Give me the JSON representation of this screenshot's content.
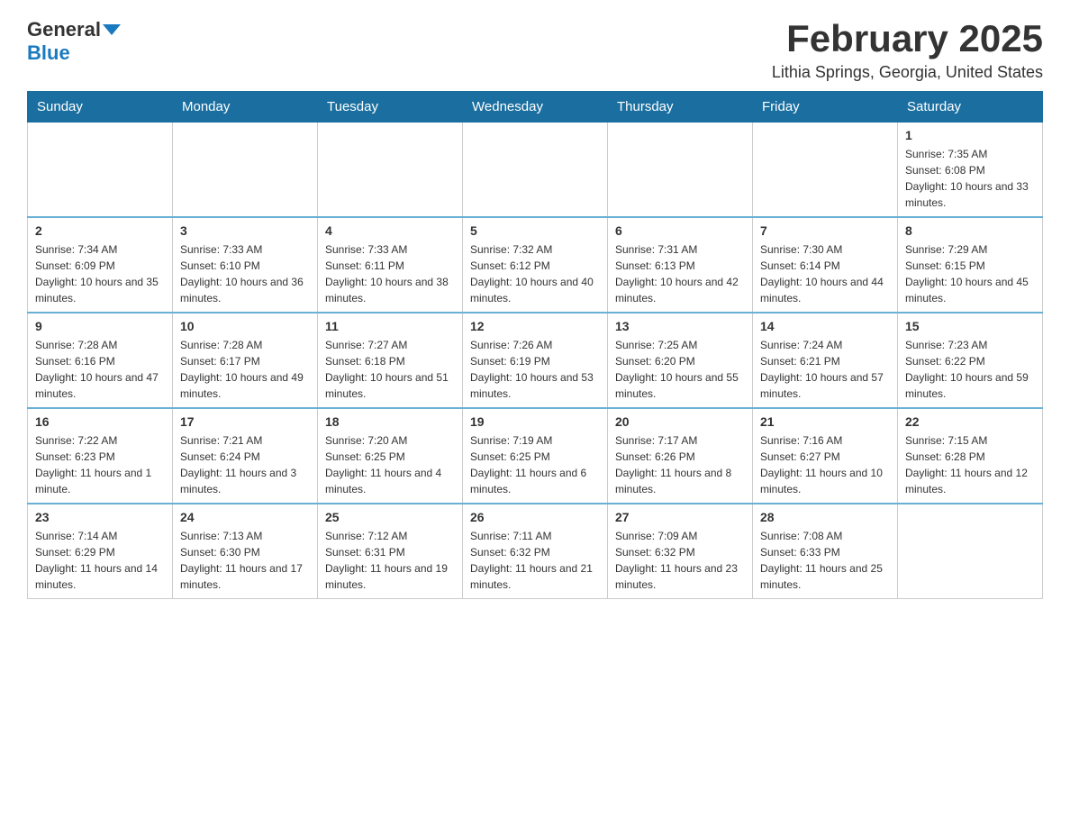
{
  "header": {
    "logo_text_black": "General",
    "logo_text_blue": "Blue",
    "month_title": "February 2025",
    "location": "Lithia Springs, Georgia, United States"
  },
  "days_of_week": [
    "Sunday",
    "Monday",
    "Tuesday",
    "Wednesday",
    "Thursday",
    "Friday",
    "Saturday"
  ],
  "weeks": [
    [
      {
        "day": "",
        "info": ""
      },
      {
        "day": "",
        "info": ""
      },
      {
        "day": "",
        "info": ""
      },
      {
        "day": "",
        "info": ""
      },
      {
        "day": "",
        "info": ""
      },
      {
        "day": "",
        "info": ""
      },
      {
        "day": "1",
        "info": "Sunrise: 7:35 AM\nSunset: 6:08 PM\nDaylight: 10 hours and 33 minutes."
      }
    ],
    [
      {
        "day": "2",
        "info": "Sunrise: 7:34 AM\nSunset: 6:09 PM\nDaylight: 10 hours and 35 minutes."
      },
      {
        "day": "3",
        "info": "Sunrise: 7:33 AM\nSunset: 6:10 PM\nDaylight: 10 hours and 36 minutes."
      },
      {
        "day": "4",
        "info": "Sunrise: 7:33 AM\nSunset: 6:11 PM\nDaylight: 10 hours and 38 minutes."
      },
      {
        "day": "5",
        "info": "Sunrise: 7:32 AM\nSunset: 6:12 PM\nDaylight: 10 hours and 40 minutes."
      },
      {
        "day": "6",
        "info": "Sunrise: 7:31 AM\nSunset: 6:13 PM\nDaylight: 10 hours and 42 minutes."
      },
      {
        "day": "7",
        "info": "Sunrise: 7:30 AM\nSunset: 6:14 PM\nDaylight: 10 hours and 44 minutes."
      },
      {
        "day": "8",
        "info": "Sunrise: 7:29 AM\nSunset: 6:15 PM\nDaylight: 10 hours and 45 minutes."
      }
    ],
    [
      {
        "day": "9",
        "info": "Sunrise: 7:28 AM\nSunset: 6:16 PM\nDaylight: 10 hours and 47 minutes."
      },
      {
        "day": "10",
        "info": "Sunrise: 7:28 AM\nSunset: 6:17 PM\nDaylight: 10 hours and 49 minutes."
      },
      {
        "day": "11",
        "info": "Sunrise: 7:27 AM\nSunset: 6:18 PM\nDaylight: 10 hours and 51 minutes."
      },
      {
        "day": "12",
        "info": "Sunrise: 7:26 AM\nSunset: 6:19 PM\nDaylight: 10 hours and 53 minutes."
      },
      {
        "day": "13",
        "info": "Sunrise: 7:25 AM\nSunset: 6:20 PM\nDaylight: 10 hours and 55 minutes."
      },
      {
        "day": "14",
        "info": "Sunrise: 7:24 AM\nSunset: 6:21 PM\nDaylight: 10 hours and 57 minutes."
      },
      {
        "day": "15",
        "info": "Sunrise: 7:23 AM\nSunset: 6:22 PM\nDaylight: 10 hours and 59 minutes."
      }
    ],
    [
      {
        "day": "16",
        "info": "Sunrise: 7:22 AM\nSunset: 6:23 PM\nDaylight: 11 hours and 1 minute."
      },
      {
        "day": "17",
        "info": "Sunrise: 7:21 AM\nSunset: 6:24 PM\nDaylight: 11 hours and 3 minutes."
      },
      {
        "day": "18",
        "info": "Sunrise: 7:20 AM\nSunset: 6:25 PM\nDaylight: 11 hours and 4 minutes."
      },
      {
        "day": "19",
        "info": "Sunrise: 7:19 AM\nSunset: 6:25 PM\nDaylight: 11 hours and 6 minutes."
      },
      {
        "day": "20",
        "info": "Sunrise: 7:17 AM\nSunset: 6:26 PM\nDaylight: 11 hours and 8 minutes."
      },
      {
        "day": "21",
        "info": "Sunrise: 7:16 AM\nSunset: 6:27 PM\nDaylight: 11 hours and 10 minutes."
      },
      {
        "day": "22",
        "info": "Sunrise: 7:15 AM\nSunset: 6:28 PM\nDaylight: 11 hours and 12 minutes."
      }
    ],
    [
      {
        "day": "23",
        "info": "Sunrise: 7:14 AM\nSunset: 6:29 PM\nDaylight: 11 hours and 14 minutes."
      },
      {
        "day": "24",
        "info": "Sunrise: 7:13 AM\nSunset: 6:30 PM\nDaylight: 11 hours and 17 minutes."
      },
      {
        "day": "25",
        "info": "Sunrise: 7:12 AM\nSunset: 6:31 PM\nDaylight: 11 hours and 19 minutes."
      },
      {
        "day": "26",
        "info": "Sunrise: 7:11 AM\nSunset: 6:32 PM\nDaylight: 11 hours and 21 minutes."
      },
      {
        "day": "27",
        "info": "Sunrise: 7:09 AM\nSunset: 6:32 PM\nDaylight: 11 hours and 23 minutes."
      },
      {
        "day": "28",
        "info": "Sunrise: 7:08 AM\nSunset: 6:33 PM\nDaylight: 11 hours and 25 minutes."
      },
      {
        "day": "",
        "info": ""
      }
    ]
  ]
}
